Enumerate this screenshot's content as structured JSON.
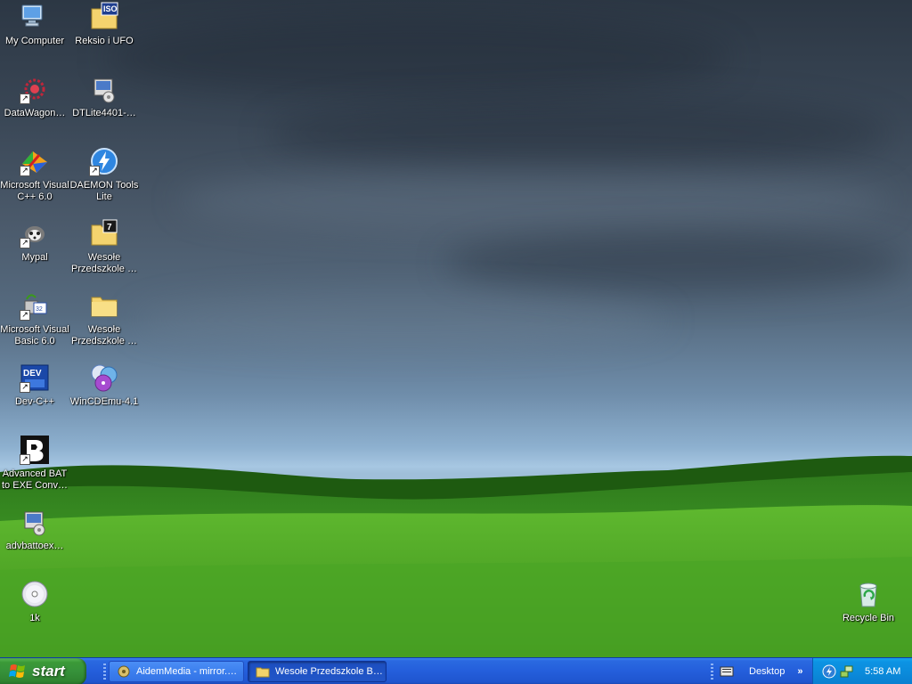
{
  "desktop": {
    "icons_col1": [
      {
        "label": "My Computer",
        "icon": "computer-icon",
        "shortcut": false
      },
      {
        "label": "DataWagon…",
        "icon": "datawagon-icon",
        "shortcut": true
      },
      {
        "label": "Microsoft Visual C++ 6.0",
        "icon": "visual-cpp-icon",
        "shortcut": true
      },
      {
        "label": "Mypal",
        "icon": "mypal-icon",
        "shortcut": true
      },
      {
        "label": "Microsoft Visual Basic 6.0",
        "icon": "visual-basic-icon",
        "shortcut": true
      },
      {
        "label": "Dev-C++",
        "icon": "dev-cpp-icon",
        "shortcut": true
      },
      {
        "label": "Advanced BAT to EXE Conv…",
        "icon": "bat-to-exe-icon",
        "shortcut": true
      },
      {
        "label": "advbattoex…",
        "icon": "installer-icon",
        "shortcut": false
      },
      {
        "label": "1k",
        "icon": "disc-icon",
        "shortcut": false
      }
    ],
    "icons_col2": [
      {
        "label": "Reksio i UFO",
        "icon": "iso-file-icon",
        "shortcut": false
      },
      {
        "label": "DTLite4401-…",
        "icon": "installer-icon",
        "shortcut": false
      },
      {
        "label": "DAEMON Tools Lite",
        "icon": "daemon-tools-icon",
        "shortcut": true
      },
      {
        "label": "Wesołe Przedszkole …",
        "icon": "archive-7z-icon",
        "shortcut": false
      },
      {
        "label": "Wesołe Przedszkole …",
        "icon": "folder-icon",
        "shortcut": false
      },
      {
        "label": "WinCDEmu-4.1",
        "icon": "wincdemu-icon",
        "shortcut": false
      }
    ],
    "recycle_bin": {
      "label": "Recycle Bin",
      "icon": "recycle-bin-icon"
    }
  },
  "taskbar": {
    "start_label": "start",
    "tasks": [
      {
        "label": "AidemMedia - mirror.…",
        "icon": "app-window-icon",
        "active": false
      },
      {
        "label": "Wesołe Przedszkole B…",
        "icon": "folder-icon",
        "active": true
      }
    ],
    "toolbar_label": "Desktop",
    "toolbar_chevron": "»",
    "clock": "5:58 AM"
  },
  "colors": {
    "taskbar_blue": "#245edb",
    "start_green": "#36913a",
    "tray_blue": "#0b8cdc"
  }
}
